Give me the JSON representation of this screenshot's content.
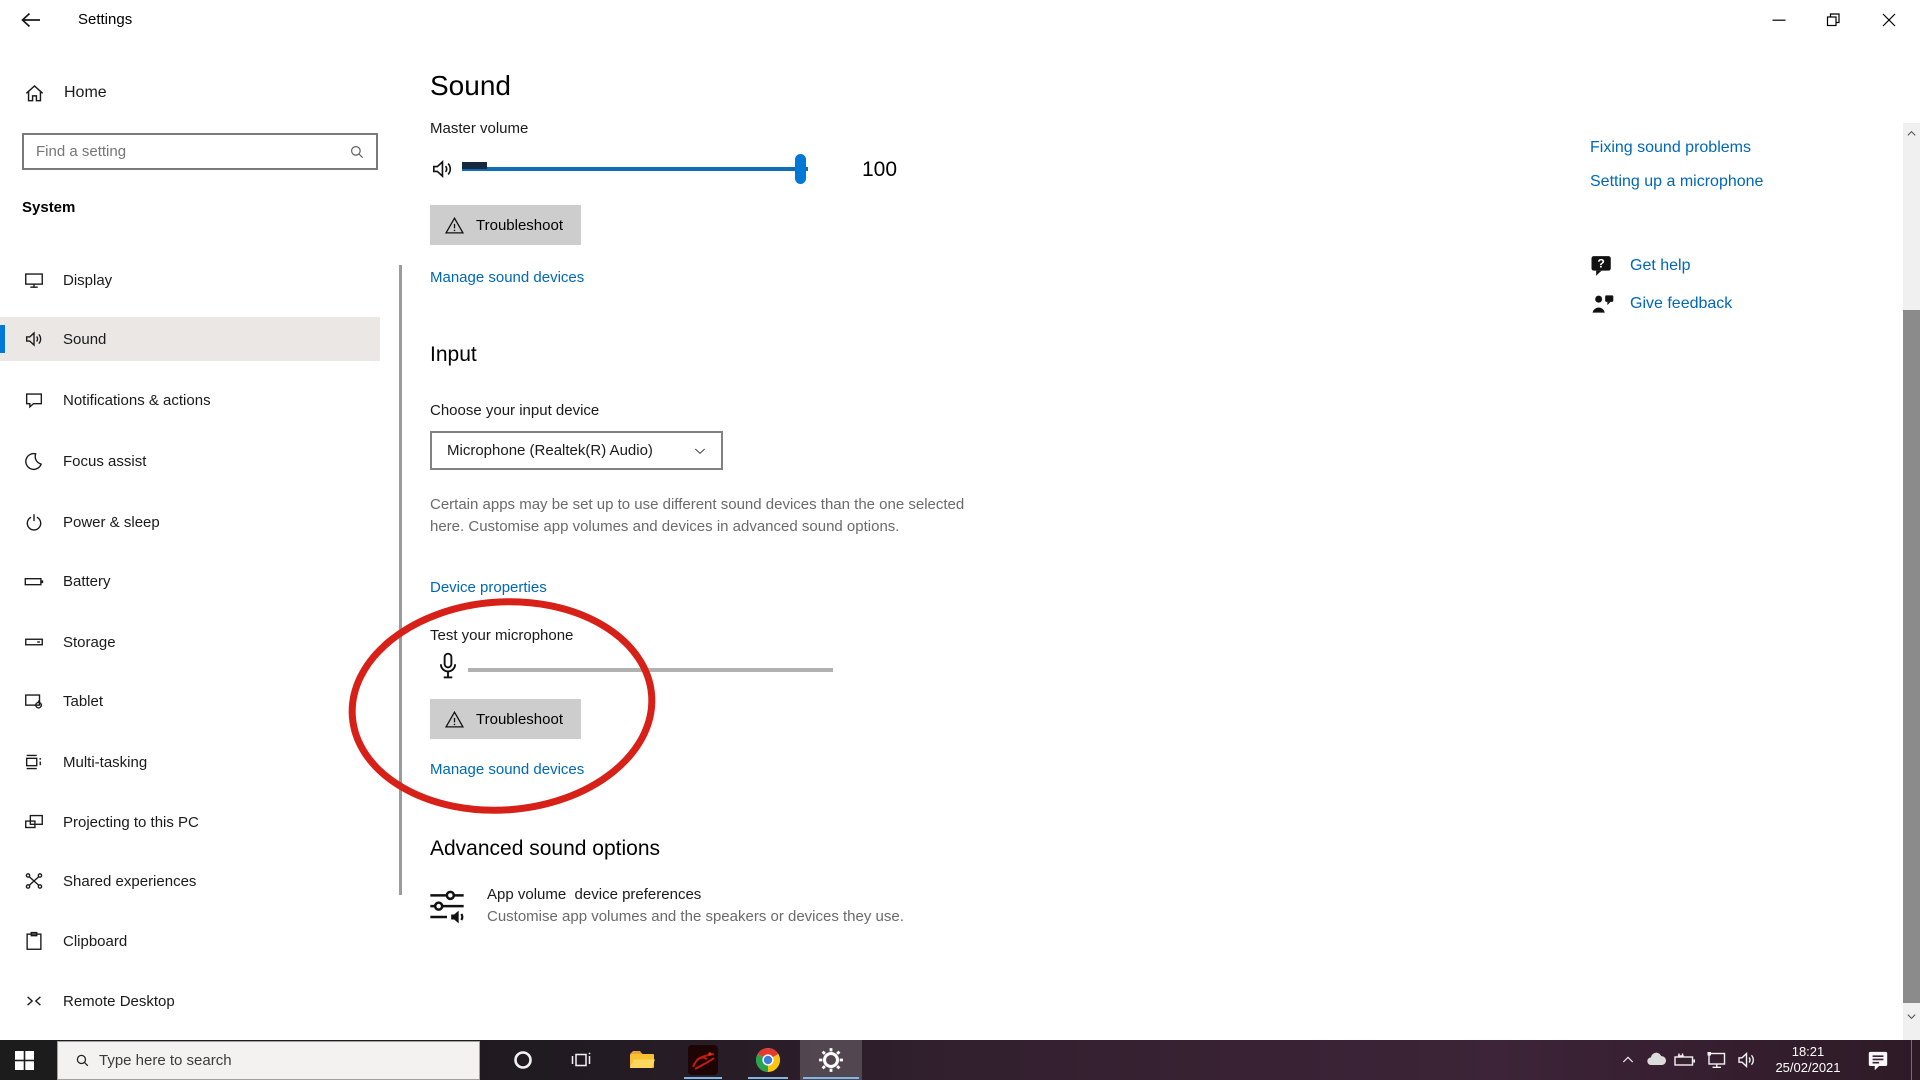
{
  "titlebar": {
    "app_title": "Settings"
  },
  "sidebar": {
    "home_label": "Home",
    "search_placeholder": "Find a setting",
    "section_label": "System",
    "items": [
      {
        "label": "Display"
      },
      {
        "label": "Sound",
        "selected": true
      },
      {
        "label": "Notifications & actions"
      },
      {
        "label": "Focus assist"
      },
      {
        "label": "Power & sleep"
      },
      {
        "label": "Battery"
      },
      {
        "label": "Storage"
      },
      {
        "label": "Tablet"
      },
      {
        "label": "Multi-tasking"
      },
      {
        "label": "Projecting to this PC"
      },
      {
        "label": "Shared experiences"
      },
      {
        "label": "Clipboard"
      },
      {
        "label": "Remote Desktop"
      }
    ]
  },
  "main": {
    "page_title": "Sound",
    "output": {
      "master_volume_label": "Master volume",
      "volume_value": "100",
      "troubleshoot_label": "Troubleshoot",
      "manage_link": "Manage sound devices"
    },
    "input": {
      "section_title": "Input",
      "choose_label": "Choose your input device",
      "selected_device": "Microphone (Realtek(R) Audio)",
      "apps_note": "Certain apps may be set up to use different sound devices than the one selected here. Customise app volumes and devices in advanced sound options.",
      "device_properties_link": "Device properties",
      "test_mic_label": "Test your microphone",
      "troubleshoot_label": "Troubleshoot",
      "manage_link": "Manage sound devices"
    },
    "advanced": {
      "section_title": "Advanced sound options",
      "app_volume_title": "App volume  device preferences",
      "app_volume_subtitle": "Customise app volumes and the speakers or devices they use."
    }
  },
  "help_panel": {
    "links": [
      {
        "label": "Fixing sound problems"
      },
      {
        "label": "Setting up a microphone"
      }
    ],
    "get_help_label": "Get help",
    "give_feedback_label": "Give feedback"
  },
  "taskbar": {
    "search_placeholder": "Type here to search",
    "clock_time": "18:21",
    "clock_date": "25/02/2021"
  },
  "colors": {
    "accent": "#0078d7",
    "link_blue": "#0067b8",
    "annotation_red": "#d62018"
  }
}
